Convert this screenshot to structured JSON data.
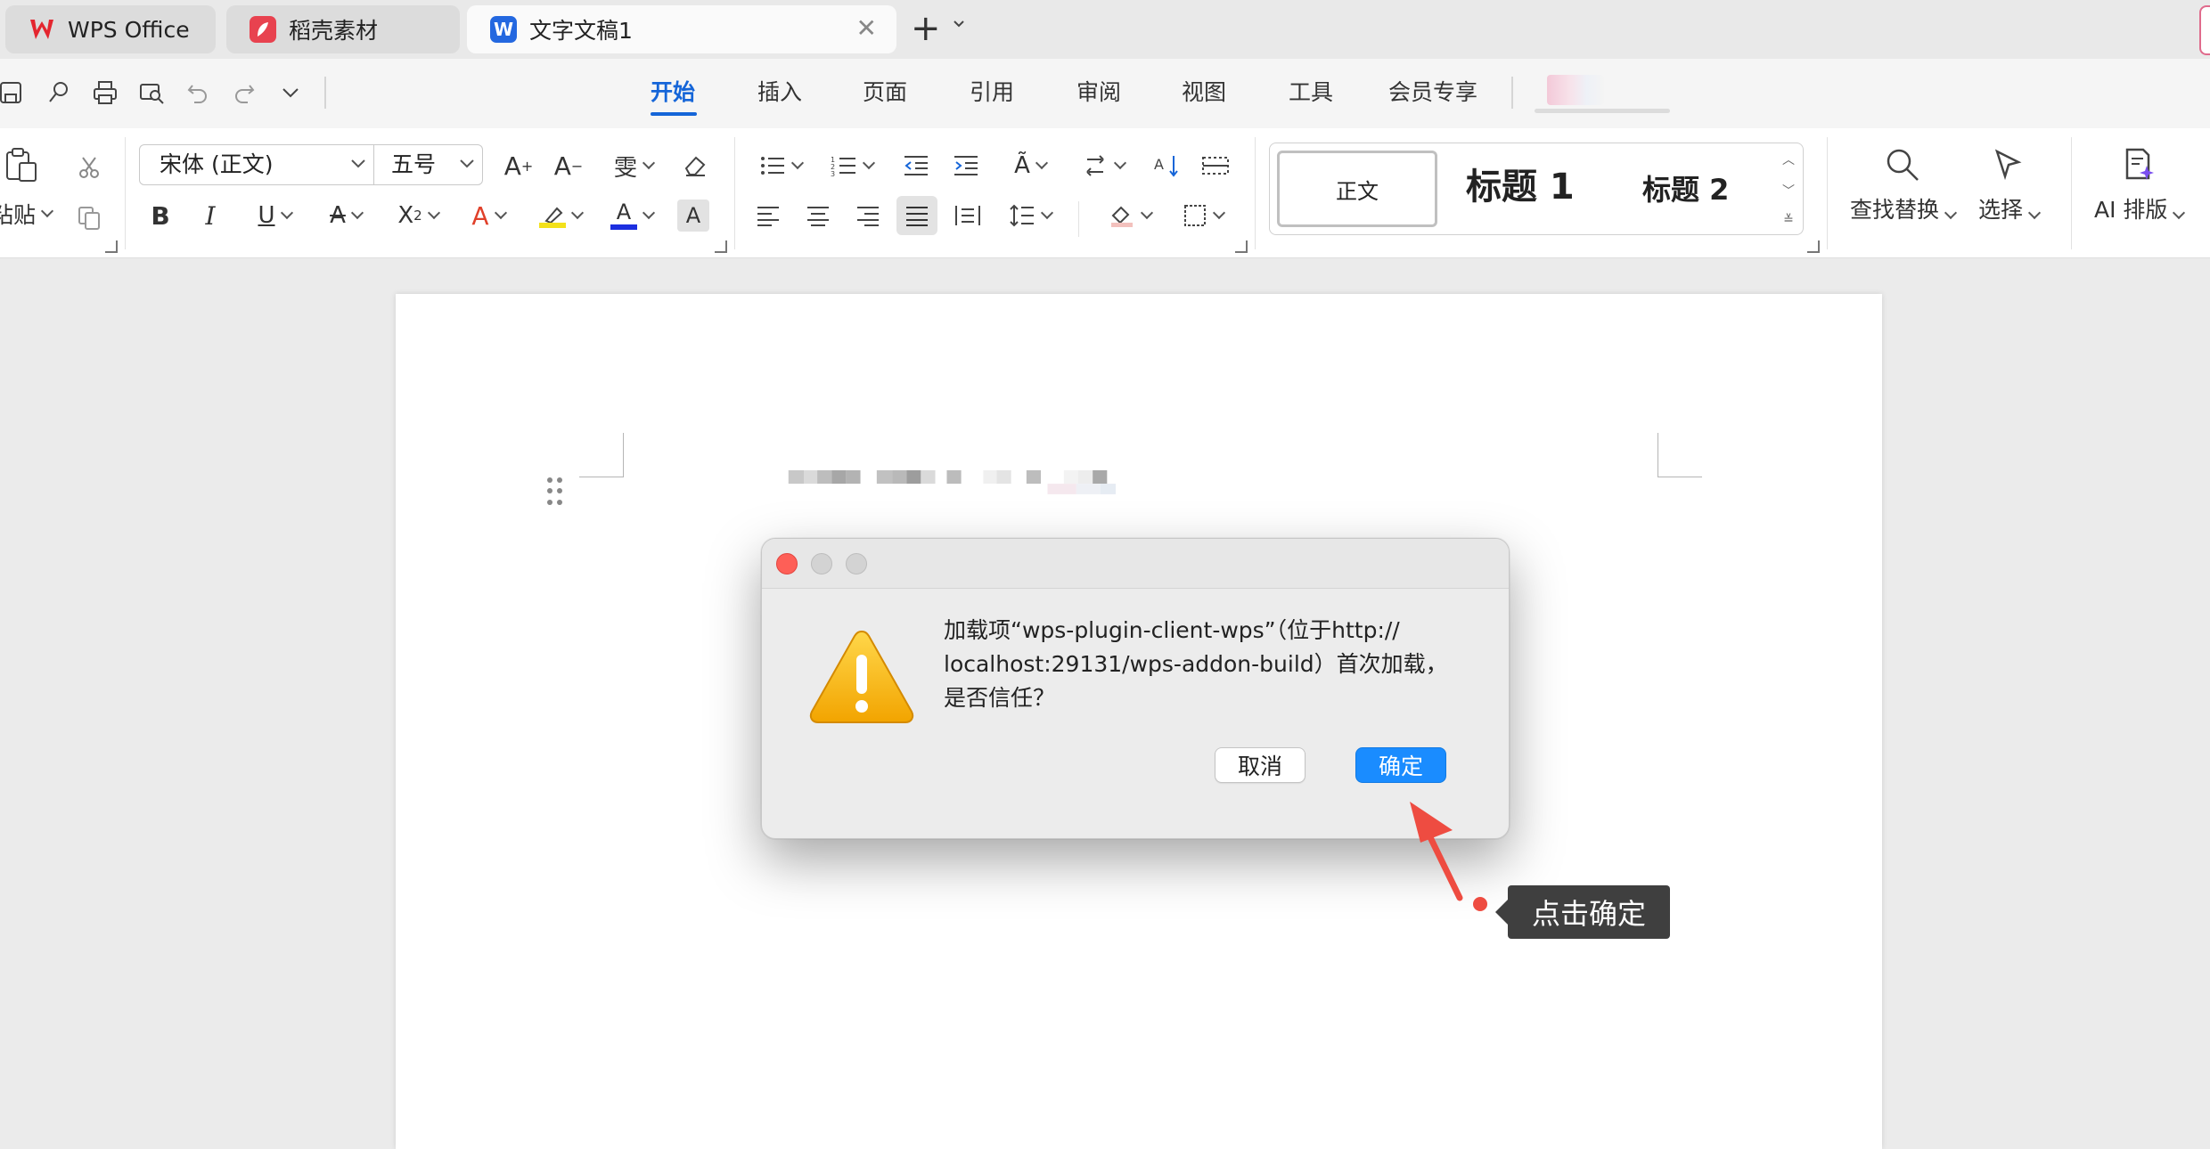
{
  "tabs": [
    {
      "label": "WPS Office",
      "icon": "wps-logo-icon"
    },
    {
      "label": "稻壳素材",
      "icon": "daoke-logo-icon"
    },
    {
      "label": "文字文稿1",
      "icon": "word-doc-icon",
      "active": true
    }
  ],
  "menu": {
    "items": [
      "开始",
      "插入",
      "页面",
      "引用",
      "审阅",
      "视图",
      "工具",
      "会员专享"
    ],
    "active": "开始"
  },
  "ribbon": {
    "paste_label": "粘贴",
    "font_name": "宋体 (正文)",
    "font_size": "五号",
    "styles": {
      "normal": "正文",
      "heading1": "标题 1",
      "heading2": "标题 2"
    },
    "find_replace": "查找替换",
    "select": "选择",
    "ai_layout": "AI 排版"
  },
  "dialog": {
    "message": "加载项“wps-plugin-client-wps”（位于http://\nlocalhost:29131/wps-addon-build）首次加载，\n是否信任？",
    "cancel": "取消",
    "confirm": "确定"
  },
  "annotation": {
    "label": "点击确定"
  },
  "colors": {
    "accent": "#1565d8",
    "confirm_button": "#1a8cff",
    "annotation_red": "#ee4c41",
    "annotation_bg": "#3f3f3f"
  }
}
